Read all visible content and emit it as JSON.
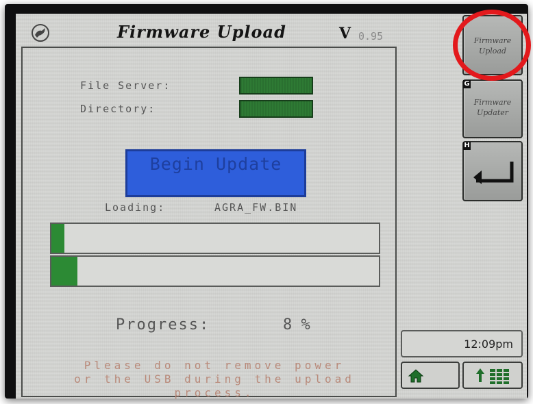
{
  "header": {
    "title": "Firmware Upload",
    "version_prefix": "V",
    "version_number": "0.95",
    "logo_icon": "deere-leaping-deer-icon"
  },
  "form": {
    "file_server_label": "File Server:",
    "directory_label": "Directory:",
    "begin_update_label": "Begin Update"
  },
  "status": {
    "loading_label": "Loading:",
    "loading_file": "AGRA_FW.BIN",
    "bar1_fraction": 0.04,
    "bar2_fraction": 0.08,
    "progress_label": "Progress:",
    "progress_value": "8 %"
  },
  "warning": {
    "line1": "Please do not remove power",
    "line2": "or the USB during the upload",
    "line3": "process."
  },
  "softkeys": {
    "firmware_upload_line1": "Firmware",
    "firmware_upload_line2": "Upload",
    "firmware_updater_letter": "G",
    "firmware_updater_line1": "Firmware",
    "firmware_updater_line2": "Updater",
    "back_letter": "H"
  },
  "footer": {
    "clock": "12:09pm",
    "home_icon": "home-icon",
    "menu_icon": "menu-up-grid-icon"
  },
  "colors": {
    "field_green": "#2e7a34",
    "button_blue": "#2e5edb",
    "progress_green": "#2c8a34",
    "highlight_red": "#e3191c"
  }
}
